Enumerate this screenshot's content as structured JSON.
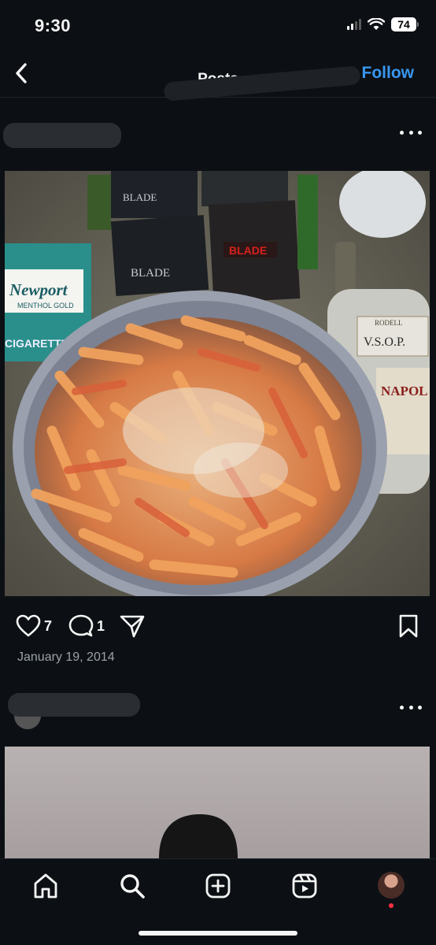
{
  "status_bar": {
    "time": "9:30",
    "battery": "74"
  },
  "nav": {
    "title": "Posts",
    "follow_label": "Follow"
  },
  "post": {
    "like_count": "7",
    "comment_count": "1",
    "date": "January 19, 2014",
    "image_text": {
      "newport_brand": "Newport",
      "newport_sub": "MENTHOL GOLD",
      "cigarettes": "CIGARETTES",
      "bottle_label": "V.S.O.P.",
      "bottle_brand": "NAPOL",
      "bottle_top": "RODELL",
      "dvd_title": "BLADE",
      "dvd_left": "BLADE",
      "dvd_trinity": "BLADE"
    }
  },
  "icons": {
    "back": "chevron-left-icon",
    "like": "heart-icon",
    "comment": "comment-icon",
    "share": "share-icon",
    "save": "bookmark-icon",
    "home": "home-icon",
    "search": "search-icon",
    "create": "plus-square-icon",
    "reels": "reels-icon"
  },
  "colors": {
    "accent": "#3897f0",
    "background": "#0c1014",
    "notification": "#ff3040"
  }
}
